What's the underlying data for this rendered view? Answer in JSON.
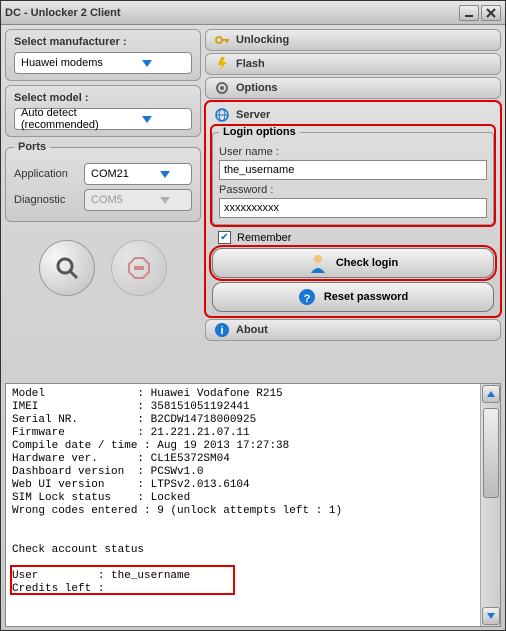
{
  "window": {
    "title": "DC - Unlocker 2 Client"
  },
  "left": {
    "manufacturer_label": "Select manufacturer :",
    "manufacturer_value": "Huawei modems",
    "model_label": "Select model :",
    "model_value": "Auto detect (recommended)",
    "ports_title": "Ports",
    "port_app_label": "Application",
    "port_app_value": "COM21",
    "port_diag_label": "Diagnostic",
    "port_diag_value": "COM5"
  },
  "accordion": {
    "unlocking": "Unlocking",
    "flash": "Flash",
    "options": "Options",
    "server": "Server",
    "about": "About"
  },
  "login": {
    "fieldset_title": "Login options",
    "username_label": "User name :",
    "username_value": "the_username",
    "password_label": "Password :",
    "password_value": "xxxxxxxxxx",
    "remember_label": "Remember",
    "remember_checked": true,
    "check_login_label": "Check login",
    "reset_password_label": "Reset password"
  },
  "log": {
    "text": "Model              : Huawei Vodafone R215\nIMEI               : 358151051192441\nSerial NR.         : B2CDW14718000925\nFirmware           : 21.221.21.07.11\nCompile date / time : Aug 19 2013 17:27:38\nHardware ver.      : CL1E5372SM04\nDashboard version  : PCSWv1.0\nWeb UI version     : LTPSv2.013.6104\nSIM Lock status    : Locked\nWrong codes entered : 9 (unlock attempts left : 1)\n\n\nCheck account status\n\nUser         : the_username\nCredits left :\n"
  }
}
